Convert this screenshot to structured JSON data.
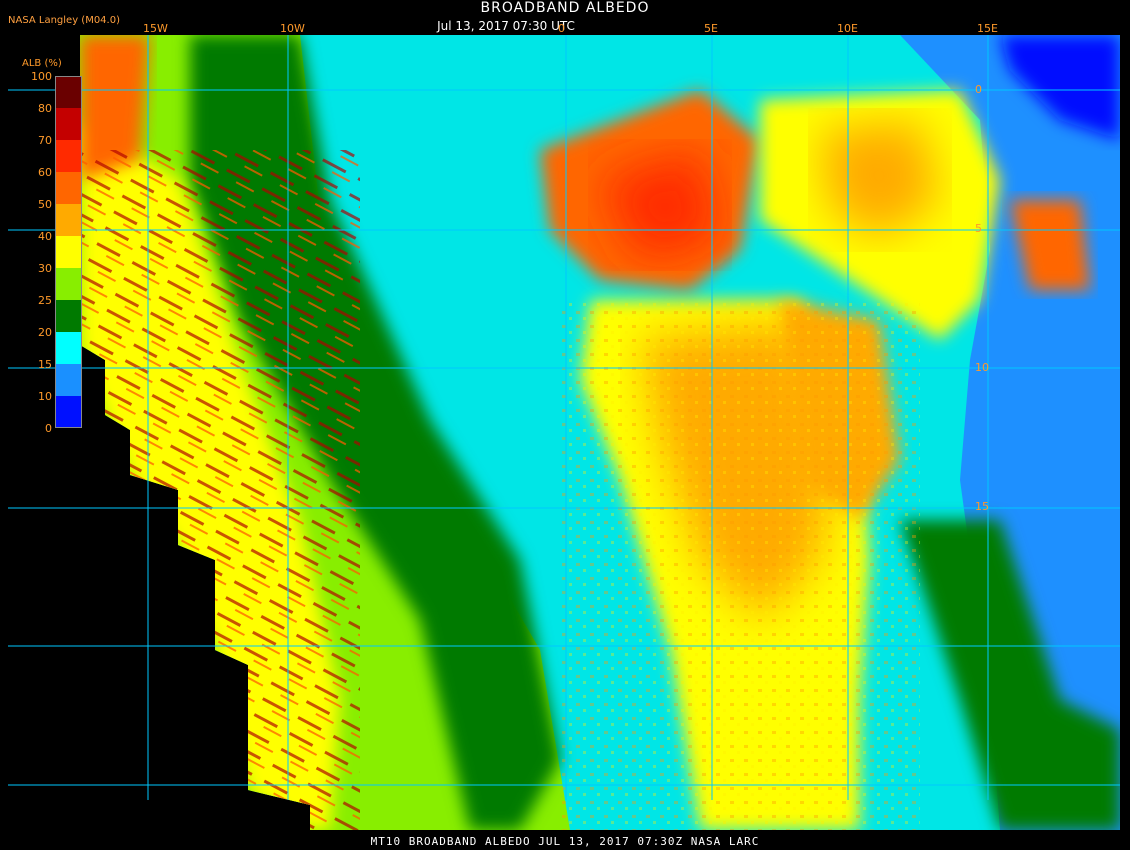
{
  "header": {
    "title": "BROADBAND ALBEDO",
    "subtitle": "Jul 13, 2017 07:30 UTC",
    "source": "NASA Langley (M04.0)"
  },
  "footer": {
    "text": "MT10  BROADBAND ALBEDO   JUL 13, 2017 07:30Z   NASA LARC"
  },
  "map": {
    "longitude_labels": [
      "15W",
      "10W",
      "0",
      "5E",
      "10E",
      "15E"
    ],
    "latitude_labels": [
      "0",
      "5",
      "10",
      "15"
    ],
    "grid_color": "#00c8ff"
  },
  "legend": {
    "title": "ALB (%)",
    "tick_labels": [
      "100",
      "80",
      "70",
      "60",
      "50",
      "40",
      "30",
      "25",
      "20",
      "15",
      "10",
      "0"
    ],
    "colors": [
      "#6a0000",
      "#c40000",
      "#ff2a00",
      "#ff6600",
      "#ffaa00",
      "#ffff00",
      "#88ee00",
      "#007a00",
      "#00ffff",
      "#1a90ff",
      "#0010ff",
      "#8a2be2"
    ]
  }
}
